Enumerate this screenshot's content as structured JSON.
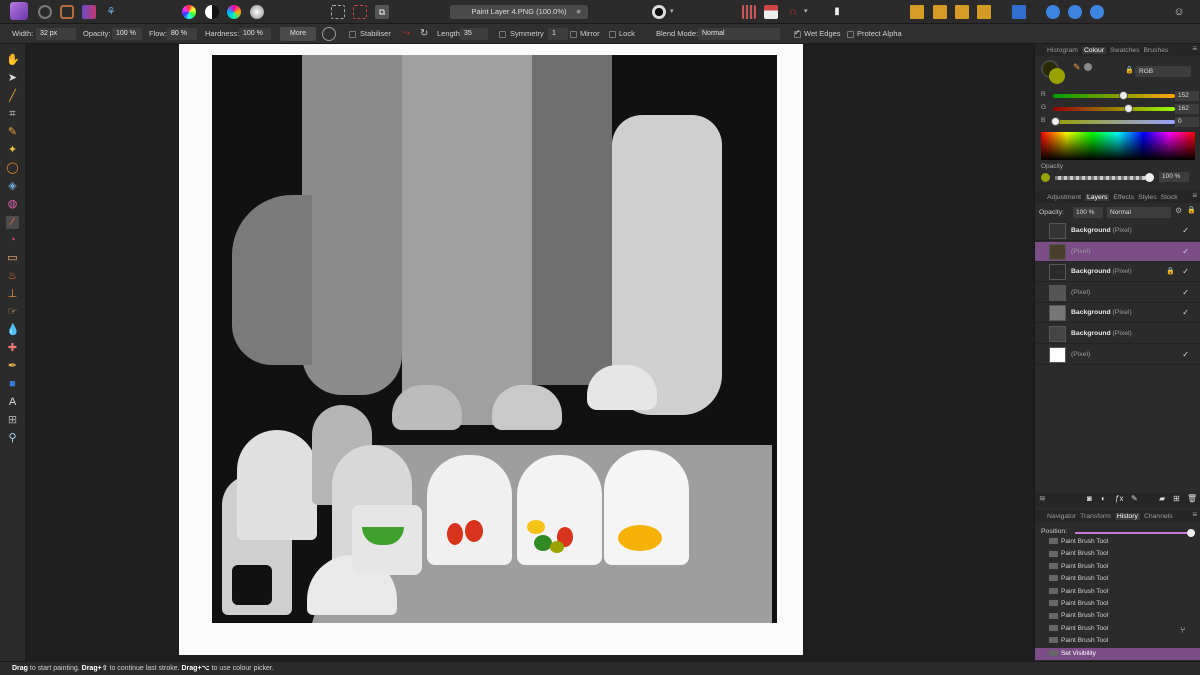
{
  "document": {
    "title": "Paint Layer 4.PNG (100.0%)"
  },
  "context_toolbar": {
    "width_label": "Width:",
    "width_value": "32 px",
    "opacity_label": "Opacity:",
    "opacity_value": "100 %",
    "flow_label": "Flow:",
    "flow_value": "80 %",
    "hardness_label": "Hardness:",
    "hardness_value": "100 %",
    "more_label": "More",
    "stabiliser_label": "Stabiliser",
    "length_label": "Length",
    "length_value": "35",
    "symmetry_label": "Symmetry",
    "symmetry_value": "1",
    "mirror_label": "Mirror",
    "lock_label": "Lock",
    "blend_label": "Blend Mode:",
    "blend_value": "Normal",
    "wet_edges_label": "Wet Edges",
    "protect_alpha_label": "Protect Alpha"
  },
  "colour_panel": {
    "tabs": [
      "Histogram",
      "Colour",
      "Swatches",
      "Brushes"
    ],
    "active_tab": "Colour",
    "model": "RGB",
    "channels": [
      {
        "label": "R",
        "value": "152"
      },
      {
        "label": "G",
        "value": "162"
      },
      {
        "label": "B",
        "value": "0"
      }
    ],
    "opacity_label": "Opacity",
    "opacity_value": "100 %",
    "current_colour": "#98a200"
  },
  "layers_panel": {
    "tabs": [
      "Adjustment",
      "Layers",
      "Effects",
      "Styles",
      "Stock"
    ],
    "active_tab": "Layers",
    "opacity_label": "Opacity:",
    "opacity_value": "100 %",
    "blend_value": "Normal",
    "layers": [
      {
        "name": "Background",
        "type": "(Pixel)",
        "visible": "✓",
        "locked": ""
      },
      {
        "name": "",
        "type": "(Pixel)",
        "visible": "✓",
        "locked": "",
        "selected": true
      },
      {
        "name": "Background",
        "type": "(Pixel)",
        "visible": "✓",
        "locked": "🔒"
      },
      {
        "name": "",
        "type": "(Pixel)",
        "visible": "✓",
        "locked": ""
      },
      {
        "name": "Background",
        "type": "(Pixel)",
        "visible": "✓",
        "locked": ""
      },
      {
        "name": "Background",
        "type": "(Pixel)",
        "visible": "",
        "locked": ""
      },
      {
        "name": "",
        "type": "(Pixel)",
        "visible": "✓",
        "locked": ""
      }
    ]
  },
  "history_panel": {
    "tabs": [
      "Navigator",
      "Transform",
      "History",
      "Channels"
    ],
    "active_tab": "History",
    "position_label": "Position:",
    "entries": [
      "Paint Brush Tool",
      "Paint Brush Tool",
      "Paint Brush Tool",
      "Paint Brush Tool",
      "Paint Brush Tool",
      "Paint Brush Tool",
      "Paint Brush Tool",
      "Paint Brush Tool",
      "Paint Brush Tool",
      "Set Visibility"
    ],
    "selected_entry": "Set Visibility"
  },
  "status_bar": {
    "drag1": "Drag",
    "text1": " to start painting. ",
    "drag2": "Drag+⇧",
    "text2": " to continue last stroke. ",
    "drag3": "Drag+⌥",
    "text3": " to use colour picker."
  },
  "accent_colors": {
    "selection": "#7b4d86",
    "brand": "#9b59d0"
  }
}
